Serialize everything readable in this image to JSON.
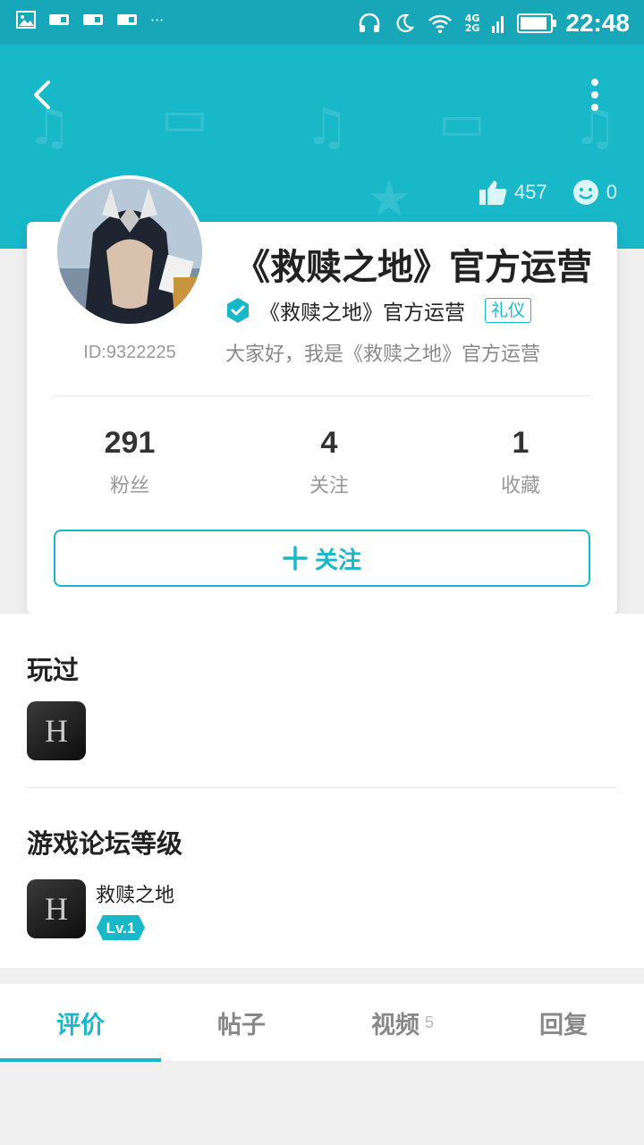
{
  "status_bar": {
    "time": "22:48",
    "network_top": "4G",
    "network_bottom": "2G",
    "battery_percent": 90
  },
  "header": {
    "likes": "457",
    "smiles": "0"
  },
  "profile": {
    "name": "《救赎之地》官方运营",
    "verified_name": "《救赎之地》官方运营",
    "tag": "礼仪",
    "id": "ID:9322225",
    "bio": "大家好，我是《救赎之地》官方运营"
  },
  "counters": [
    {
      "value": "291",
      "label": "粉丝"
    },
    {
      "value": "4",
      "label": "关注"
    },
    {
      "value": "1",
      "label": "收藏"
    }
  ],
  "follow_button": {
    "label": "关注"
  },
  "played": {
    "title": "玩过"
  },
  "forum_level": {
    "title": "游戏论坛等级",
    "game": "救赎之地",
    "level": "Lv.1"
  },
  "tabs": [
    {
      "label": "评价"
    },
    {
      "label": "帖子"
    },
    {
      "label": "视频",
      "count": "5"
    },
    {
      "label": "回复"
    }
  ],
  "colors": {
    "accent": "#19b8c9",
    "status_bar": "#17a7b8"
  }
}
